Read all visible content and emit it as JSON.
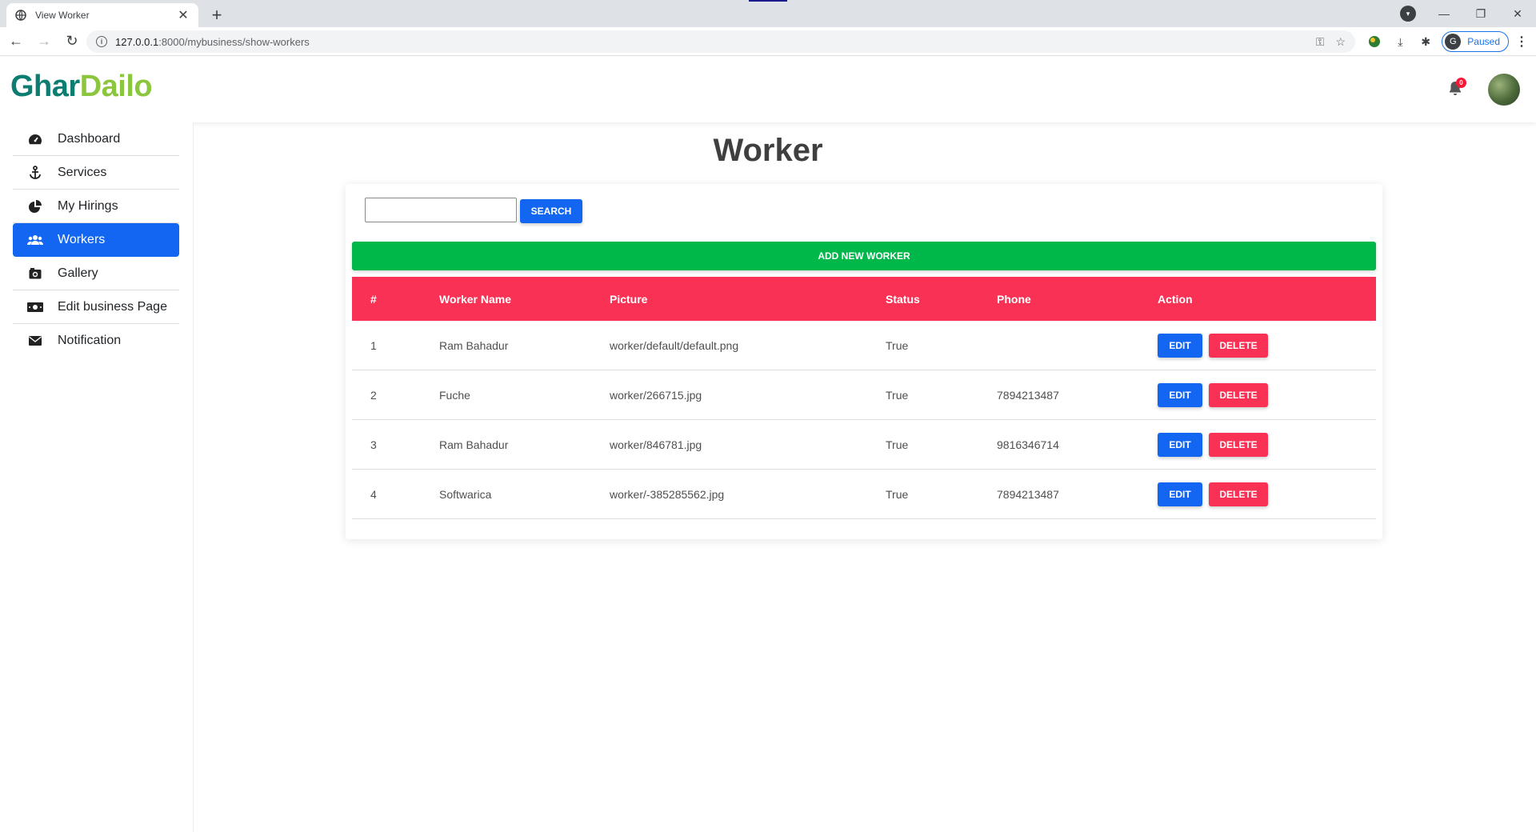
{
  "browser": {
    "tab_title": "View Worker",
    "tab_close": "✕",
    "new_tab": "+",
    "url_host": "127.0.0.1",
    "url_path": ":8000/mybusiness/show-workers",
    "profile_initial": "G",
    "profile_status": "Paused"
  },
  "header": {
    "logo_part1": "Ghar",
    "logo_part2": "Dailo",
    "notification_count": "0"
  },
  "sidebar": {
    "items": [
      {
        "label": "Dashboard",
        "icon": "tachometer-icon",
        "active": false
      },
      {
        "label": "Services",
        "icon": "anchor-icon",
        "active": false
      },
      {
        "label": "My Hirings",
        "icon": "pie-chart-icon",
        "active": false
      },
      {
        "label": "Workers",
        "icon": "users-icon",
        "active": true
      },
      {
        "label": "Gallery",
        "icon": "camera-icon",
        "active": false
      },
      {
        "label": "Edit business Page",
        "icon": "money-bill-icon",
        "active": false
      },
      {
        "label": "Notification",
        "icon": "envelope-icon",
        "active": false
      }
    ]
  },
  "main": {
    "title": "Worker",
    "search_value": "",
    "search_button": "SEARCH",
    "add_button": "ADD NEW WORKER",
    "table": {
      "headers": [
        "#",
        "Worker Name",
        "Picture",
        "Status",
        "Phone",
        "Action"
      ],
      "rows": [
        {
          "num": "1",
          "name": "Ram Bahadur",
          "picture": "worker/default/default.png",
          "status": "True",
          "phone": ""
        },
        {
          "num": "2",
          "name": "Fuche",
          "picture": "worker/266715.jpg",
          "status": "True",
          "phone": "7894213487"
        },
        {
          "num": "3",
          "name": "Ram Bahadur",
          "picture": "worker/846781.jpg",
          "status": "True",
          "phone": "9816346714"
        },
        {
          "num": "4",
          "name": "Softwarica",
          "picture": "worker/-385285562.jpg",
          "status": "True",
          "phone": "7894213487"
        }
      ],
      "edit_label": "EDIT",
      "delete_label": "DELETE"
    }
  },
  "colors": {
    "primary": "#1266f1",
    "danger": "#f93154",
    "success": "#00b74a",
    "logo_teal": "#0d7d71",
    "logo_green": "#8cc63f"
  }
}
